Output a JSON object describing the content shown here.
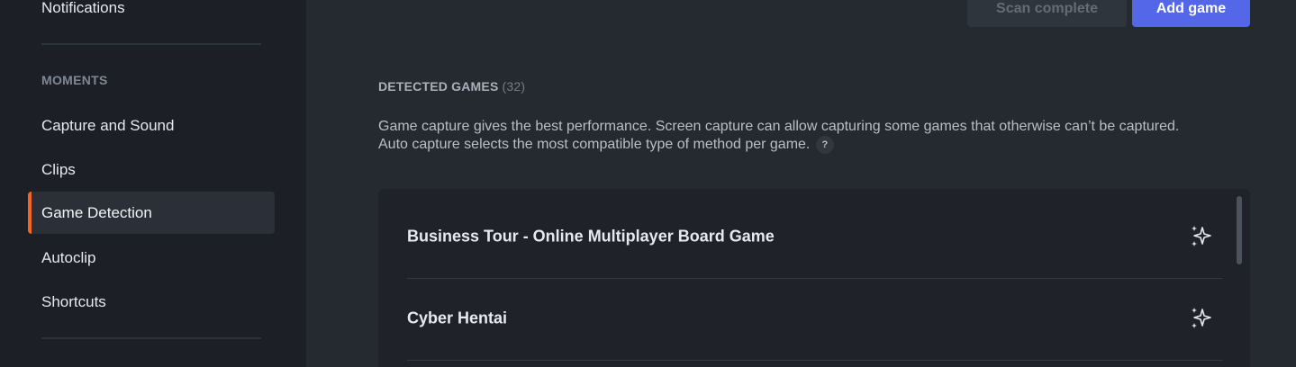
{
  "sidebar": {
    "items": [
      {
        "label": "Notifications"
      },
      {
        "label": "Capture and Sound"
      },
      {
        "label": "Clips"
      },
      {
        "label": "Game Detection"
      },
      {
        "label": "Autoclip"
      },
      {
        "label": "Shortcuts"
      }
    ],
    "section_label": "MOMENTS",
    "active_item": "Game Detection",
    "accent_color": "#f2661f"
  },
  "toolbar": {
    "scan_label": "Scan complete",
    "add_label": "Add game",
    "add_color": "#5467e8"
  },
  "main": {
    "heading": "DETECTED GAMES",
    "count": "(32)",
    "description_line1": "Game capture gives the best performance. Screen capture can allow capturing some games that otherwise can’t be captured.",
    "description_line2": "Auto capture selects the most compatible type of method per game.",
    "help_label": "?",
    "games": [
      {
        "name": "Business Tour - Online Multiplayer Board Game",
        "icon": "sparkles-icon"
      },
      {
        "name": "Cyber Hentai",
        "icon": "sparkles-icon"
      }
    ]
  }
}
